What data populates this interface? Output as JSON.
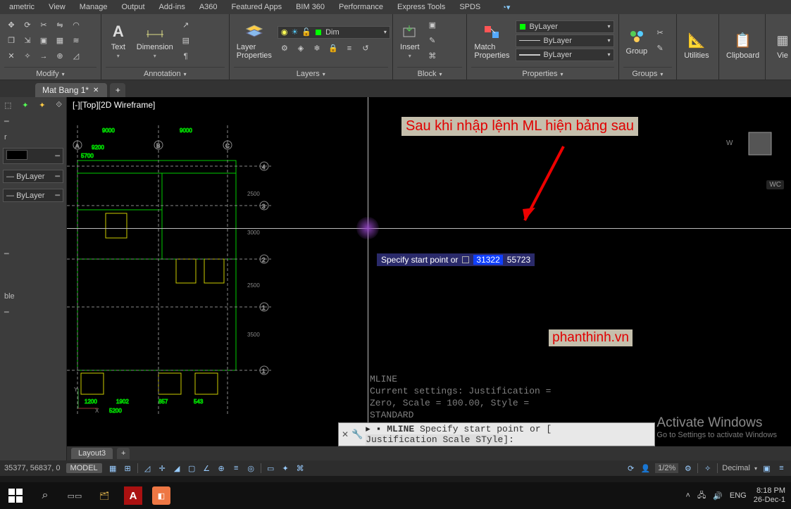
{
  "menubar": [
    "ametric",
    "View",
    "Manage",
    "Output",
    "Add-ins",
    "A360",
    "Featured Apps",
    "BIM 360",
    "Performance",
    "Express Tools",
    "SPDS"
  ],
  "ribbon": {
    "modify_label": "Modify",
    "annot_label": "Annotation",
    "text_label": "Text",
    "dim_label": "Dimension",
    "layers_label": "Layers",
    "layerprops_label": "Layer\nProperties",
    "layer_combo": "Dim",
    "block_label": "Block",
    "insert_label": "Insert",
    "match_label": "Match\nProperties",
    "props_label": "Properties",
    "prop_layer": "ByLayer",
    "prop_linetype": "ByLayer",
    "prop_lw": "ByLayer",
    "groups_label": "Groups",
    "group_label": "Group",
    "util_label": "Utilities",
    "clip_label": "Clipboard",
    "view_label": "Vie"
  },
  "tabs": {
    "active": "Mat Bang 1*"
  },
  "viewport_label": "[-][Top][2D Wireframe]",
  "leftpanel": {
    "row1": "r",
    "bylayer": "ByLayer",
    "ble": "ble"
  },
  "dyninput": {
    "prompt": "Specify start point or",
    "val1": "31322",
    "val2": "55723"
  },
  "annotation": "Sau khi nhập lệnh ML hiện bảng sau",
  "brand": "phanthinh.vn",
  "cmd_history": "MLINE\nCurrent settings: Justification =\nZero, Scale = 100.00, Style =\nSTANDARD",
  "cmdline": {
    "a": "MLINE",
    "b": " Specify start point or [ ",
    "c": "Justification",
    "d": " Scale",
    "e": " STyle",
    "f": "]:"
  },
  "watermark": {
    "l1": "Activate Windows",
    "l2": "Go to Settings to activate Windows"
  },
  "wcs": "WC",
  "vcube_w": "W",
  "layouttab": "Layout3",
  "status": {
    "coords": "35377, 56837, 0",
    "model": "MODEL",
    "scale": "1/2%",
    "decimal": "Decimal"
  },
  "taskbar": {
    "lang": "ENG",
    "time": "8:18 PM",
    "date": "26-Dec-1"
  }
}
